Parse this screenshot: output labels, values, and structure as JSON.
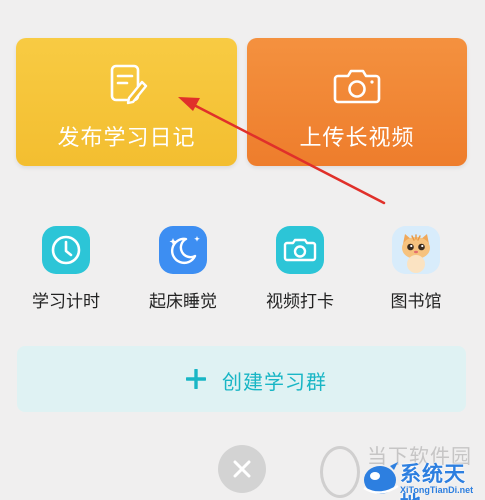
{
  "cards": {
    "diary": {
      "label": "发布学习日记",
      "icon": "edit-note-icon",
      "color": "#f6c63c"
    },
    "video": {
      "label": "上传长视频",
      "icon": "camera-icon",
      "color": "#f08733"
    }
  },
  "tools": [
    {
      "label": "学习计时",
      "icon": "clock-icon",
      "color": "#2cc5d7"
    },
    {
      "label": "起床睡觉",
      "icon": "moon-stars-icon",
      "color": "#3d8ef2"
    },
    {
      "label": "视频打卡",
      "icon": "camera-icon",
      "color": "#2cc5d7"
    },
    {
      "label": "图书馆",
      "icon": "cat-avatar-icon",
      "color": "#d8ecfb"
    }
  ],
  "create_group": {
    "label": "创建学习群",
    "icon": "plus-icon",
    "color": "#19b6c5"
  },
  "close": {
    "icon": "close-icon"
  },
  "annotation": {
    "icon": "red-arrow-annotation",
    "color": "#e0302a"
  },
  "watermark": {
    "top_text": "当下软件园",
    "brand": "系统天地",
    "url": "XiTongTianDi.net"
  }
}
